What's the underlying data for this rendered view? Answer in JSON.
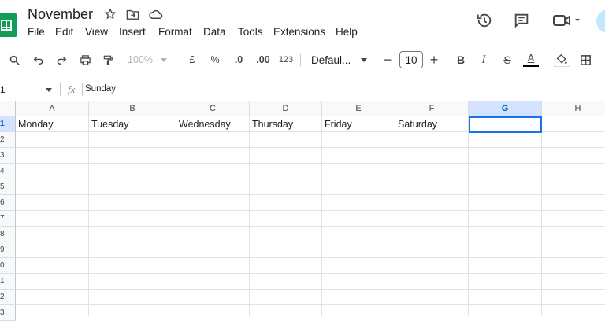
{
  "app": {
    "doc_title": "November",
    "menu": [
      "File",
      "Edit",
      "View",
      "Insert",
      "Format",
      "Data",
      "Tools",
      "Extensions",
      "Help"
    ]
  },
  "toolbar": {
    "zoom": "100%",
    "currency": "£",
    "percent": "%",
    "decrease_decimal": ".0",
    "increase_decimal": ".00",
    "number_format": "123",
    "font": "Defaul...",
    "font_size": "10",
    "minus": "−",
    "plus": "+",
    "bold": "B",
    "italic": "I",
    "strike": "S",
    "text_color": "A"
  },
  "formula_bar": {
    "name_box": "1",
    "fx": "fx",
    "content": "Sunday"
  },
  "grid": {
    "columns": [
      "A",
      "B",
      "C",
      "D",
      "E",
      "F",
      "G",
      "H"
    ],
    "rows": [
      "1",
      "2",
      "3",
      "4",
      "5",
      "6",
      "7",
      "8",
      "9",
      "0",
      "1",
      "2",
      "3"
    ],
    "row1": [
      "Monday",
      "Tuesday",
      "Wednesday",
      "Thursday",
      "Friday",
      "Saturday",
      "",
      ""
    ],
    "selected_cell": "G1"
  },
  "colors": {
    "brand_green": "#0f9d58",
    "selection_blue": "#1a73e8",
    "selected_header": "#d3e3fd"
  }
}
